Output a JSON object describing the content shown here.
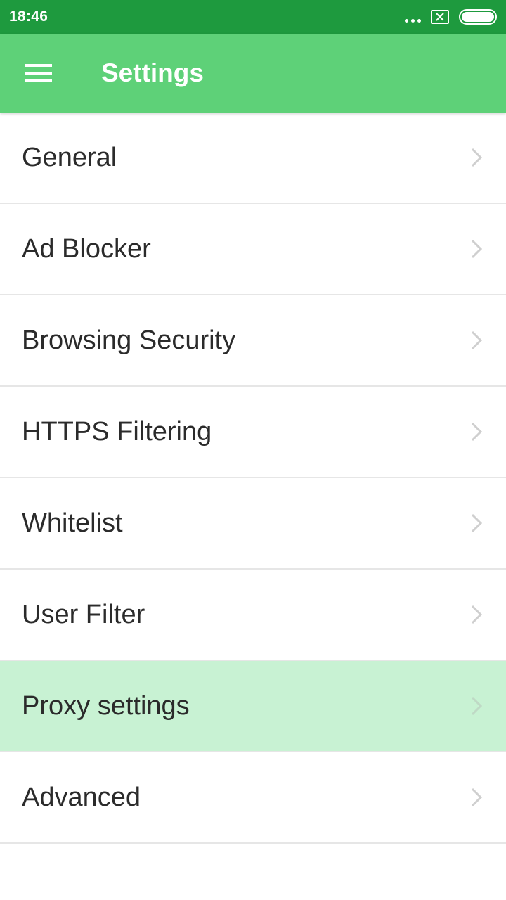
{
  "status_bar": {
    "time": "18:46",
    "icons": [
      "more-dots-icon",
      "sim-no-service-icon",
      "battery-full-icon"
    ]
  },
  "app_bar": {
    "menu_icon": "hamburger-menu-icon",
    "title": "Settings",
    "background": "#5ed178"
  },
  "settings": {
    "items": [
      {
        "label": "General"
      },
      {
        "label": "Ad Blocker"
      },
      {
        "label": "Browsing Security"
      },
      {
        "label": "HTTPS Filtering"
      },
      {
        "label": "Whitelist"
      },
      {
        "label": "User Filter"
      },
      {
        "label": "Proxy settings",
        "selected": true
      },
      {
        "label": "Advanced"
      }
    ],
    "chevron_icon": "chevron-right-icon",
    "selected_color": "#c8f2d3"
  }
}
